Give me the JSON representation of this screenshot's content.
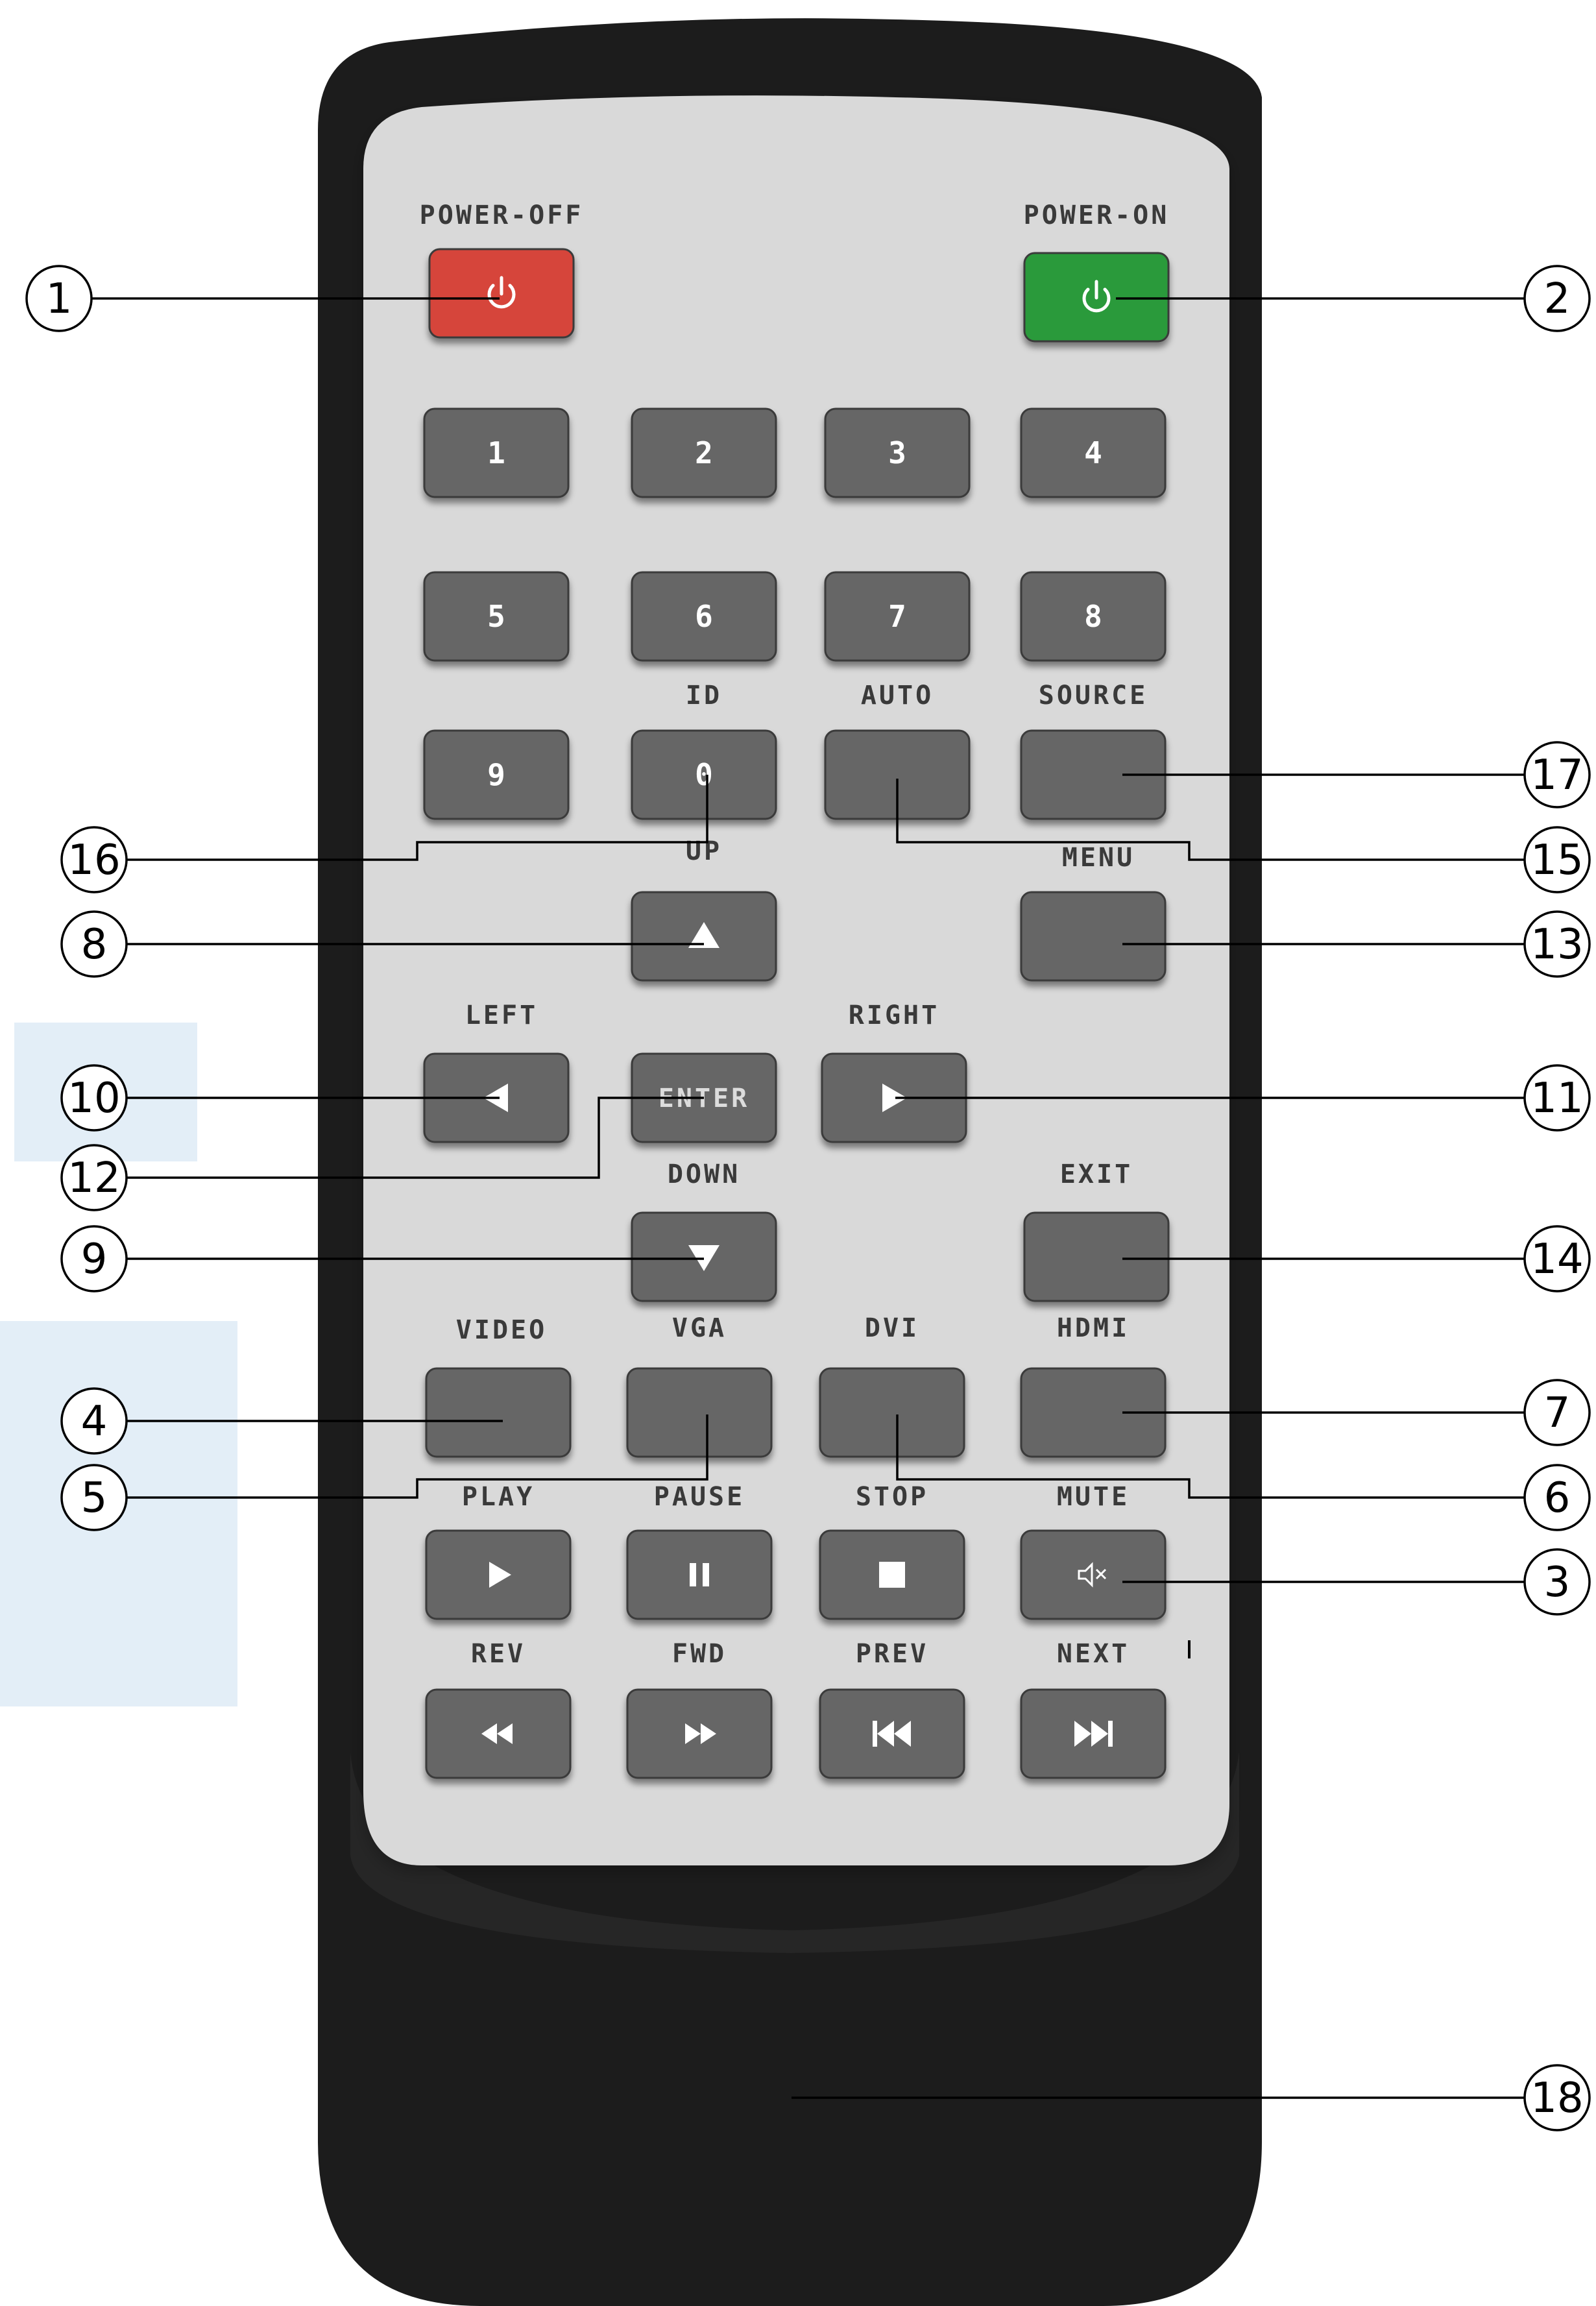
{
  "colors": {
    "remote_body": "#1c1c1c",
    "panel": "#d9d9d9",
    "button": "#666666",
    "button_border": "#3a3a3a",
    "power_off": "#d6453b",
    "power_on": "#2a9a3a",
    "label": "#3a3a3a",
    "highlight": "#e3eef7"
  },
  "buttons": {
    "power_off": {
      "label": "POWER-OFF",
      "icon": "power-icon"
    },
    "power_on": {
      "label": "POWER-ON",
      "icon": "power-icon"
    },
    "num_1": {
      "text": "1"
    },
    "num_2": {
      "text": "2"
    },
    "num_3": {
      "text": "3"
    },
    "num_4": {
      "text": "4"
    },
    "num_5": {
      "text": "5"
    },
    "num_6": {
      "text": "6"
    },
    "num_7": {
      "text": "7"
    },
    "num_8": {
      "text": "8"
    },
    "num_9": {
      "text": "9"
    },
    "num_0": {
      "text": "0",
      "label": "ID"
    },
    "auto": {
      "label": "AUTO"
    },
    "source": {
      "label": "SOURCE"
    },
    "up": {
      "label": "UP",
      "icon": "triangle-up-icon"
    },
    "menu": {
      "label": "MENU"
    },
    "left": {
      "label": "LEFT",
      "icon": "triangle-left-icon"
    },
    "enter": {
      "text": "ENTER"
    },
    "right": {
      "label": "RIGHT",
      "icon": "triangle-right-icon"
    },
    "down": {
      "label": "DOWN",
      "icon": "triangle-down-icon"
    },
    "exit": {
      "label": "EXIT"
    },
    "video": {
      "label": "VIDEO"
    },
    "vga": {
      "label": "VGA"
    },
    "dvi": {
      "label": "DVI"
    },
    "hdmi": {
      "label": "HDMI"
    },
    "play": {
      "label": "PLAY",
      "icon": "play-icon"
    },
    "pause": {
      "label": "PAUSE",
      "icon": "pause-icon"
    },
    "stop": {
      "label": "STOP",
      "icon": "stop-icon"
    },
    "mute": {
      "label": "MUTE",
      "icon": "mute-icon"
    },
    "rev": {
      "label": "REV",
      "icon": "rewind-icon"
    },
    "fwd": {
      "label": "FWD",
      "icon": "fast-forward-icon"
    },
    "prev": {
      "label": "PREV",
      "icon": "skip-previous-icon"
    },
    "next": {
      "label": "NEXT",
      "icon": "skip-next-icon"
    }
  },
  "callouts": {
    "c1": "1",
    "c2": "2",
    "c3": "3",
    "c4": "4",
    "c5": "5",
    "c6": "6",
    "c7": "7",
    "c8": "8",
    "c9": "9",
    "c10": "10",
    "c11": "11",
    "c12": "12",
    "c13": "13",
    "c14": "14",
    "c15": "15",
    "c16": "16",
    "c17": "17",
    "c18": "18"
  }
}
